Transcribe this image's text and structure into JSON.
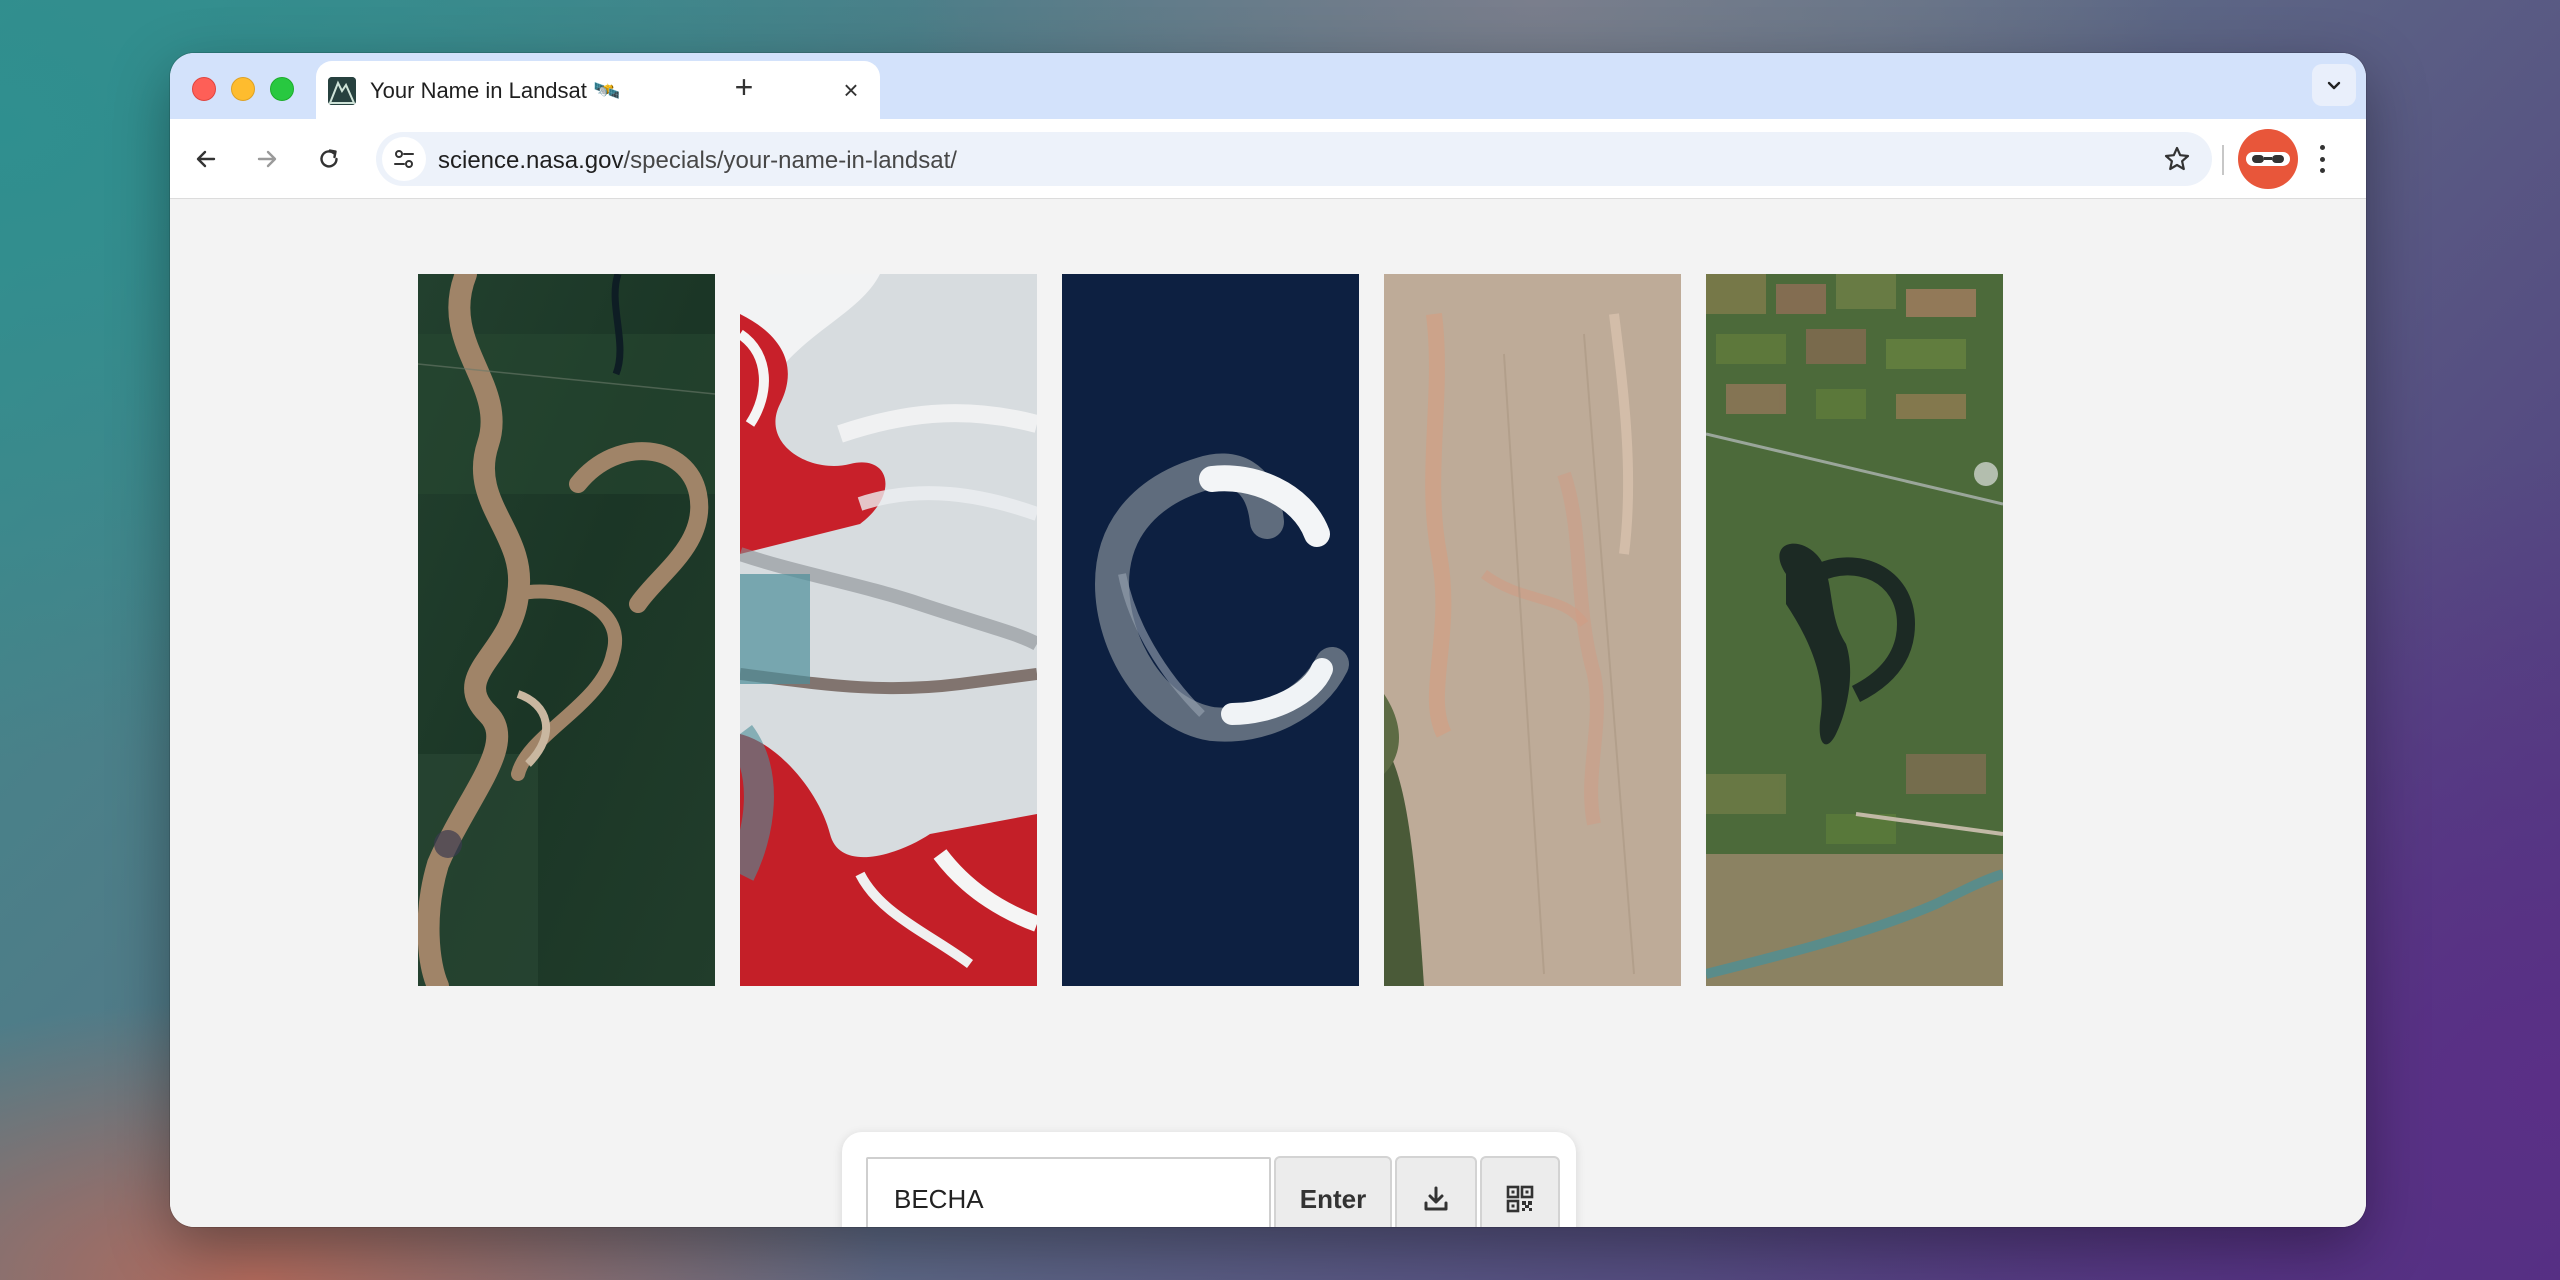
{
  "browser": {
    "tab_title": "Your Name in Landsat 🛰️",
    "tab_close": "×",
    "new_tab": "+",
    "url_domain": "science.nasa.gov",
    "url_path": "/specials/your-name-in-landsat/"
  },
  "page": {
    "letters": [
      "B",
      "E",
      "C",
      "H",
      "A"
    ],
    "name_input_value": "BECHA",
    "enter_label": "Enter"
  },
  "colors": {
    "tab_strip": "#d3e2fb",
    "profile_accent": "#e8563a",
    "page_background": "#f3f3f3"
  }
}
